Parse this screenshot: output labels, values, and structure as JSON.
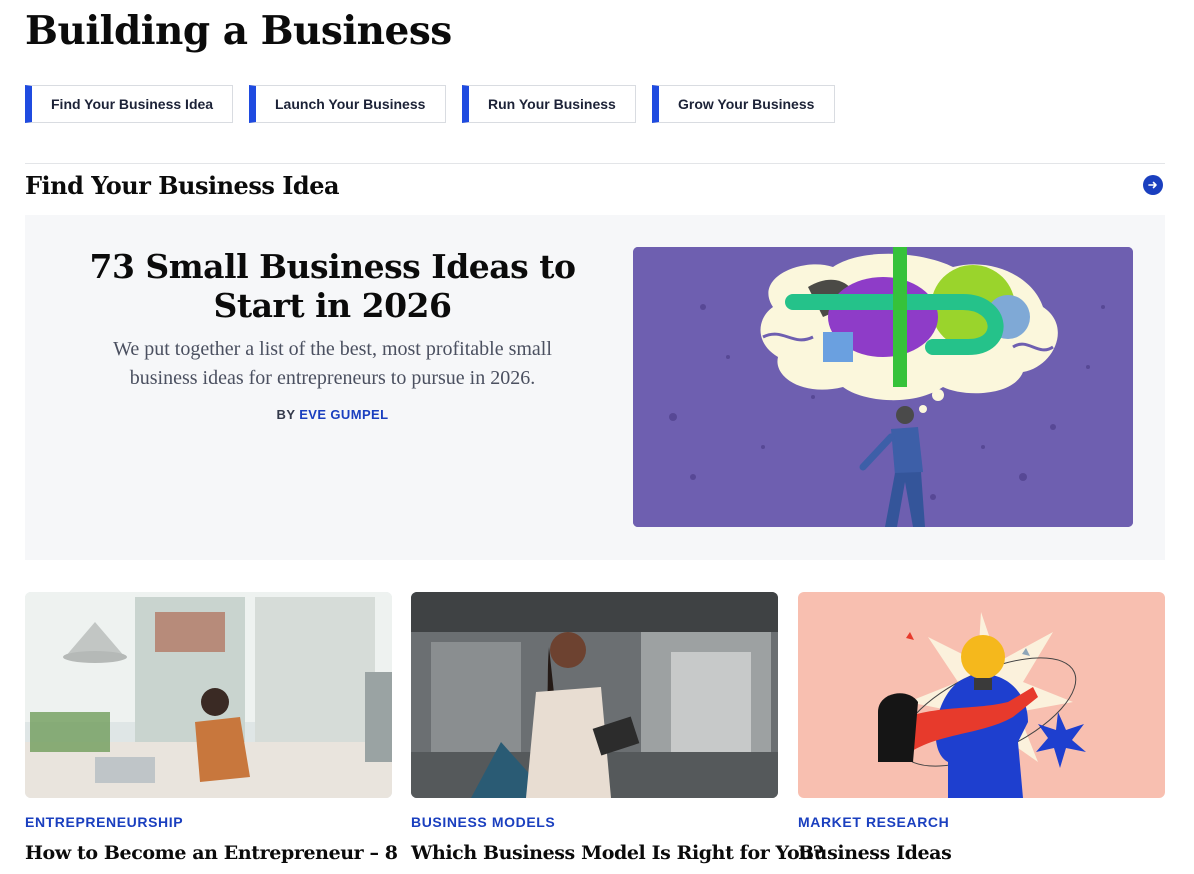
{
  "page_title": "Building a Business",
  "nav_pills": [
    {
      "label": "Find Your Business Idea"
    },
    {
      "label": "Launch Your Business"
    },
    {
      "label": "Run Your Business"
    },
    {
      "label": "Grow Your Business"
    }
  ],
  "section": {
    "title": "Find Your Business Idea",
    "arrow_icon": "arrow-right-circle-icon"
  },
  "featured": {
    "title": "73 Small Business Ideas to Start in 2026",
    "description": "We put together a list of the best, most profitable small business ideas for entrepreneurs to pursue in 2026.",
    "byline_prefix": "BY",
    "author": "EVE GUMPEL"
  },
  "cards": [
    {
      "tag": "ENTREPRENEURSHIP",
      "title": "How to Become an Entrepreneur – 8"
    },
    {
      "tag": "BUSINESS MODELS",
      "title": "Which Business Model Is Right for You?"
    },
    {
      "tag": "MARKET RESEARCH",
      "title": "Business Ideas"
    }
  ],
  "colors": {
    "accent": "#1f4be0",
    "link": "#1a3fbf",
    "feature_bg": "#f6f7f9",
    "illustration_purple": "#6e5fb0",
    "illustration_peach": "#f8bfb0"
  }
}
